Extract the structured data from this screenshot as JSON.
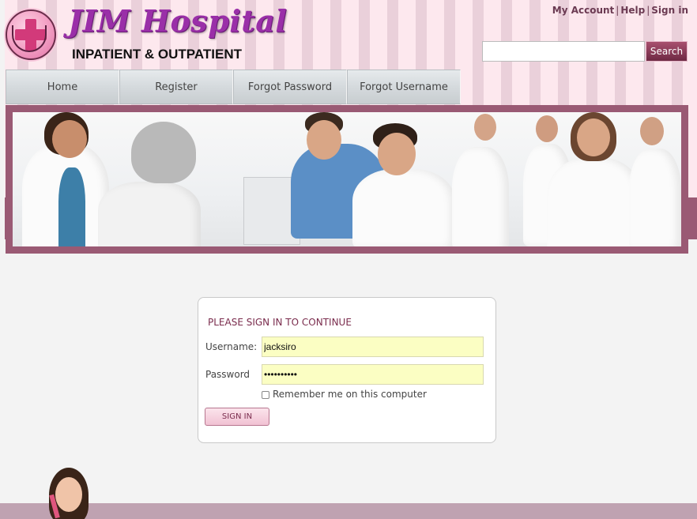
{
  "brand": {
    "name": "JIM Hospital",
    "subtitle": "INPATIENT & OUTPATIENT",
    "accent": "#9a5a74"
  },
  "top_links": {
    "my_account": "My Account",
    "help": "Help",
    "sign_in": "Sign in",
    "separator": "|"
  },
  "search": {
    "placeholder": "",
    "button_label": "Search"
  },
  "nav": {
    "items": [
      {
        "label": "Home"
      },
      {
        "label": "Register"
      },
      {
        "label": "Forgot Password"
      },
      {
        "label": "Forgot Username"
      }
    ]
  },
  "login": {
    "title": "PLEASE SIGN IN TO CONTINUE",
    "username_label": "Username:",
    "username_value": "jacksiro",
    "password_label": "Password",
    "password_value": "••••••••••",
    "remember_label": "Remember me on this computer",
    "remember_checked": false,
    "submit_label": "SIGN IN"
  },
  "icons": {
    "logo": "medical-cross-logo-icon",
    "checkbox": "checkbox-icon"
  }
}
